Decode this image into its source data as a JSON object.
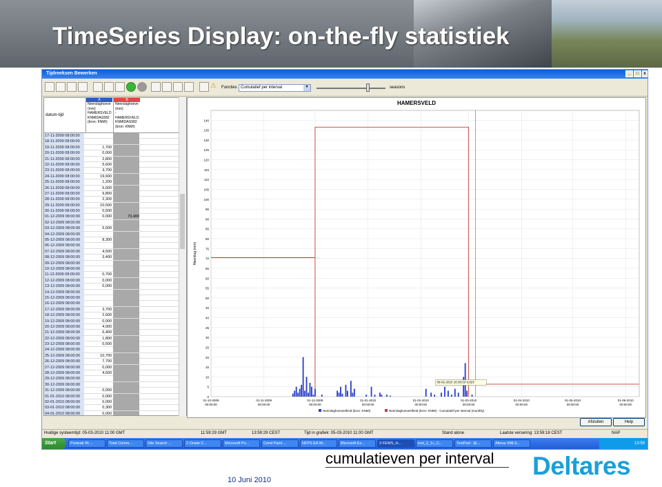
{
  "slide": {
    "title": "TimeSeries Display: on-the-fly statistiek",
    "caption": "cumulatieven per interval",
    "date": "10 Juni 2010",
    "logo_text": "Deltares",
    "logo_color": "#1aa0d8"
  },
  "window": {
    "title": "Tijdreeksen Bewerken",
    "controls": [
      "_",
      "□",
      "x"
    ]
  },
  "toolbar": {
    "functions_label": "Functies",
    "functions_value": "Cumulatief per interval",
    "seasons_label": "seasons",
    "icons": [
      "table-icon",
      "graph-icon",
      "list-icon",
      "grid-icon",
      "zoom-in-icon",
      "zoom-out-icon",
      "zoom-reset-icon",
      "refresh-green-icon",
      "stop-icon",
      "table-graph-icon",
      "line-graph-icon",
      "wave-graph-icon",
      "edit-graph-icon",
      "save-icon",
      "warning-icon"
    ]
  },
  "table": {
    "datum_header": "datum-tijd",
    "columns": [
      {
        "letter": "A",
        "lines": [
          "Neerslaghoeve",
          "(mm)",
          "HAMERSVELD",
          "KNMIDAG582",
          "(bron: KNMI)"
        ]
      },
      {
        "letter": "B",
        "lines": [
          "Neerslaghoeve",
          "(mm)",
          "-HAMERSVELD",
          "KNMIDAG582",
          "(bron: KNMI)"
        ]
      }
    ],
    "rows": [
      {
        "d": "17-11-2009 08:00:00",
        "a": "",
        "b": ""
      },
      {
        "d": "18-11-2009 08:00:00",
        "a": "",
        "b": ""
      },
      {
        "d": "19-11-2009 08:00:00",
        "a": "1,700",
        "b": ""
      },
      {
        "d": "20-11-2009 08:00:00",
        "a": "0,000",
        "b": ""
      },
      {
        "d": "21-11-2009 08:00:00",
        "a": "2,800",
        "b": ""
      },
      {
        "d": "22-11-2009 08:00:00",
        "a": "5,600",
        "b": ""
      },
      {
        "d": "23-11-2009 08:00:00",
        "a": "3,700",
        "b": ""
      },
      {
        "d": "24-11-2009 08:00:00",
        "a": "19,600",
        "b": ""
      },
      {
        "d": "25-11-2009 08:00:00",
        "a": "1,200",
        "b": ""
      },
      {
        "d": "26-11-2009 08:00:00",
        "a": "5,600",
        "b": ""
      },
      {
        "d": "27-11-2009 08:00:00",
        "a": "9,800",
        "b": ""
      },
      {
        "d": "28-11-2009 08:00:00",
        "a": "2,300",
        "b": ""
      },
      {
        "d": "29-11-2009 08:00:00",
        "a": "10,500",
        "b": ""
      },
      {
        "d": "30-11-2009 08:00:00",
        "a": "0,500",
        "b": ""
      },
      {
        "d": "01-12-2009 08:00:00",
        "a": "0,000",
        "b": "70,400"
      },
      {
        "d": "02-12-2009 08:00:00",
        "a": "",
        "b": ""
      },
      {
        "d": "03-12-2009 08:00:00",
        "a": "6,500",
        "b": ""
      },
      {
        "d": "04-12-2009 08:00:00",
        "a": "",
        "b": ""
      },
      {
        "d": "05-12-2009 08:00:00",
        "a": "8,300",
        "b": ""
      },
      {
        "d": "06-12-2009 08:00:00",
        "a": "",
        "b": ""
      },
      {
        "d": "07-12-2009 08:00:00",
        "a": "4,500",
        "b": ""
      },
      {
        "d": "08-12-2009 08:00:00",
        "a": "3,400",
        "b": ""
      },
      {
        "d": "09-12-2009 08:00:00",
        "a": "",
        "b": ""
      },
      {
        "d": "10-12-2009 08:00:00",
        "a": "",
        "b": ""
      },
      {
        "d": "11-12-2009 08:00:00",
        "a": "0,700",
        "b": ""
      },
      {
        "d": "12-12-2009 08:00:00",
        "a": "0,000",
        "b": ""
      },
      {
        "d": "13-12-2009 08:00:00",
        "a": "0,000",
        "b": ""
      },
      {
        "d": "14-12-2009 08:00:00",
        "a": "",
        "b": ""
      },
      {
        "d": "15-12-2009 08:00:00",
        "a": "",
        "b": ""
      },
      {
        "d": "16-12-2009 08:00:00",
        "a": "",
        "b": ""
      },
      {
        "d": "17-12-2009 08:00:00",
        "a": "3,700",
        "b": ""
      },
      {
        "d": "18-12-2009 08:00:00",
        "a": "2,600",
        "b": ""
      },
      {
        "d": "19-12-2009 08:00:00",
        "a": "0,000",
        "b": ""
      },
      {
        "d": "20-12-2009 08:00:00",
        "a": "4,900",
        "b": ""
      },
      {
        "d": "21-12-2009 08:00:00",
        "a": "6,400",
        "b": ""
      },
      {
        "d": "22-12-2009 08:00:00",
        "a": "1,800",
        "b": ""
      },
      {
        "d": "23-12-2009 08:00:00",
        "a": "0,500",
        "b": ""
      },
      {
        "d": "24-12-2009 08:00:00",
        "a": "",
        "b": ""
      },
      {
        "d": "25-12-2009 08:00:00",
        "a": "10,700",
        "b": ""
      },
      {
        "d": "26-12-2009 08:00:00",
        "a": "7,700",
        "b": ""
      },
      {
        "d": "27-12-2009 08:00:00",
        "a": "0,000",
        "b": ""
      },
      {
        "d": "28-12-2009 08:00:00",
        "a": "4,600",
        "b": ""
      },
      {
        "d": "29-12-2009 08:00:00",
        "a": "",
        "b": ""
      },
      {
        "d": "30-12-2009 08:00:00",
        "a": "",
        "b": ""
      },
      {
        "d": "31-12-2009 08:00:00",
        "a": "0,000",
        "b": ""
      },
      {
        "d": "01-01-2010 08:00:00",
        "a": "0,000",
        "b": ""
      },
      {
        "d": "02-01-2010 08:00:00",
        "a": "0,000",
        "b": ""
      },
      {
        "d": "03-01-2010 08:00:00",
        "a": "0,300",
        "b": ""
      },
      {
        "d": "04-01-2010 08:00:00",
        "a": "0,000",
        "b": ""
      }
    ]
  },
  "chart_data": {
    "type": "bar",
    "title": "HAMERSVELD",
    "ylabel": "Neerslag (mm)",
    "ylim": [
      0,
      145
    ],
    "yticks": [
      0,
      5,
      10,
      15,
      20,
      25,
      30,
      35,
      40,
      45,
      50,
      55,
      60,
      65,
      70,
      75,
      80,
      85,
      90,
      95,
      100,
      105,
      110,
      115,
      120,
      125,
      130,
      135,
      140
    ],
    "xticks": [
      {
        "label1": "01-10-2009",
        "label2": "00:00:00",
        "t": 0
      },
      {
        "label1": "01-11-2009",
        "label2": "00:00:00",
        "t": 31
      },
      {
        "label1": "01-12-2009",
        "label2": "00:00:00",
        "t": 61
      },
      {
        "label1": "01-01-2010",
        "label2": "00:00:00",
        "t": 92
      },
      {
        "label1": "01-02-2010",
        "label2": "00:00:00",
        "t": 123
      },
      {
        "label1": "01-03-2010",
        "label2": "00:00:00",
        "t": 151
      },
      {
        "label1": "01-04-2010",
        "label2": "00:00:00",
        "t": 182
      },
      {
        "label1": "01-05-2010",
        "label2": "00:00:00",
        "t": 212
      },
      {
        "label1": "01-06-2010",
        "label2": "00:00:00",
        "t": 243
      }
    ],
    "xlim": [
      0,
      251
    ],
    "bars": [
      {
        "t": 48,
        "v": 1.5
      },
      {
        "t": 49,
        "v": 3
      },
      {
        "t": 50,
        "v": 5
      },
      {
        "t": 51,
        "v": 2
      },
      {
        "t": 52,
        "v": 4
      },
      {
        "t": 53,
        "v": 6
      },
      {
        "t": 54,
        "v": 20
      },
      {
        "t": 55,
        "v": 3
      },
      {
        "t": 56,
        "v": 10
      },
      {
        "t": 57,
        "v": 2
      },
      {
        "t": 58,
        "v": 7
      },
      {
        "t": 59,
        "v": 5
      },
      {
        "t": 60,
        "v": 1
      },
      {
        "t": 61,
        "v": 4
      },
      {
        "t": 65,
        "v": 1
      },
      {
        "t": 74,
        "v": 3
      },
      {
        "t": 75,
        "v": 2
      },
      {
        "t": 76,
        "v": 5
      },
      {
        "t": 77,
        "v": 1.5
      },
      {
        "t": 79,
        "v": 6
      },
      {
        "t": 80,
        "v": 3
      },
      {
        "t": 82,
        "v": 8
      },
      {
        "t": 83,
        "v": 2
      },
      {
        "t": 84,
        "v": 4
      },
      {
        "t": 91,
        "v": 1
      },
      {
        "t": 94,
        "v": 5
      },
      {
        "t": 96,
        "v": 1
      },
      {
        "t": 99,
        "v": 2
      },
      {
        "t": 100,
        "v": 1
      },
      {
        "t": 103,
        "v": 1
      },
      {
        "t": 105,
        "v": 0.5
      },
      {
        "t": 126,
        "v": 4
      },
      {
        "t": 129,
        "v": 2
      },
      {
        "t": 131,
        "v": 1
      },
      {
        "t": 135,
        "v": 2
      },
      {
        "t": 137,
        "v": 5
      },
      {
        "t": 139,
        "v": 3
      },
      {
        "t": 141,
        "v": 1
      },
      {
        "t": 143,
        "v": 4
      },
      {
        "t": 145,
        "v": 2
      },
      {
        "t": 148,
        "v": 10
      },
      {
        "t": 149,
        "v": 17
      },
      {
        "t": 150,
        "v": 3
      },
      {
        "t": 153,
        "v": 1
      }
    ],
    "cumulative": [
      {
        "t0": 0,
        "t1": 61,
        "v": 70.4
      },
      {
        "t0": 61,
        "t1": 151,
        "v": 136.5
      },
      {
        "t0": 151,
        "t1": 251,
        "v": 6.3
      }
    ],
    "marker_t": 155,
    "tooltip": "09-02-2010 16:30:53 9,823",
    "legend": [
      {
        "label": "Neerslaghoeveelheid  (bron: KNMI)",
        "color": "#2a3fc8"
      },
      {
        "label": "Neerslaghoeveelheid  (bron: KNMI)  - Cumulatief per interval (monthly)",
        "color": "#c03a3a"
      }
    ],
    "colors": {
      "bar": "#2a3fc8",
      "cumulative": "#c03a3a",
      "marker": "#3cc13c"
    }
  },
  "buttons": {
    "afsluiten": "Afsluiten",
    "help": "Help"
  },
  "statusbar": {
    "huidige": "Huidige systeemtijd: 05-03-2010 11:00 GMT",
    "gmt": "11:59:29 GMT",
    "cest": "13:59:29 CEST",
    "tijd": "Tijd in grafiek: 05-03-2010 11:00 GMT",
    "stand": "Stand alone",
    "laatste": "Laatste versering: 13:59:18 CEST",
    "nap": "NAP"
  },
  "taskbar": {
    "start": "Start",
    "tasks": [
      "Postvak IN ...",
      "Total Comm...",
      "Site Search ...",
      "2 Orade C...",
      "Microsoft Po...",
      "Corel Paint ...",
      "NFPS EA W...",
      "Microsoft Ex...",
      "3 FEWS_H...",
      "test_2_1c_C...",
      "TextPad - [E...",
      "Altova XMLS..."
    ],
    "active_task": 8,
    "clock": "13:59"
  }
}
